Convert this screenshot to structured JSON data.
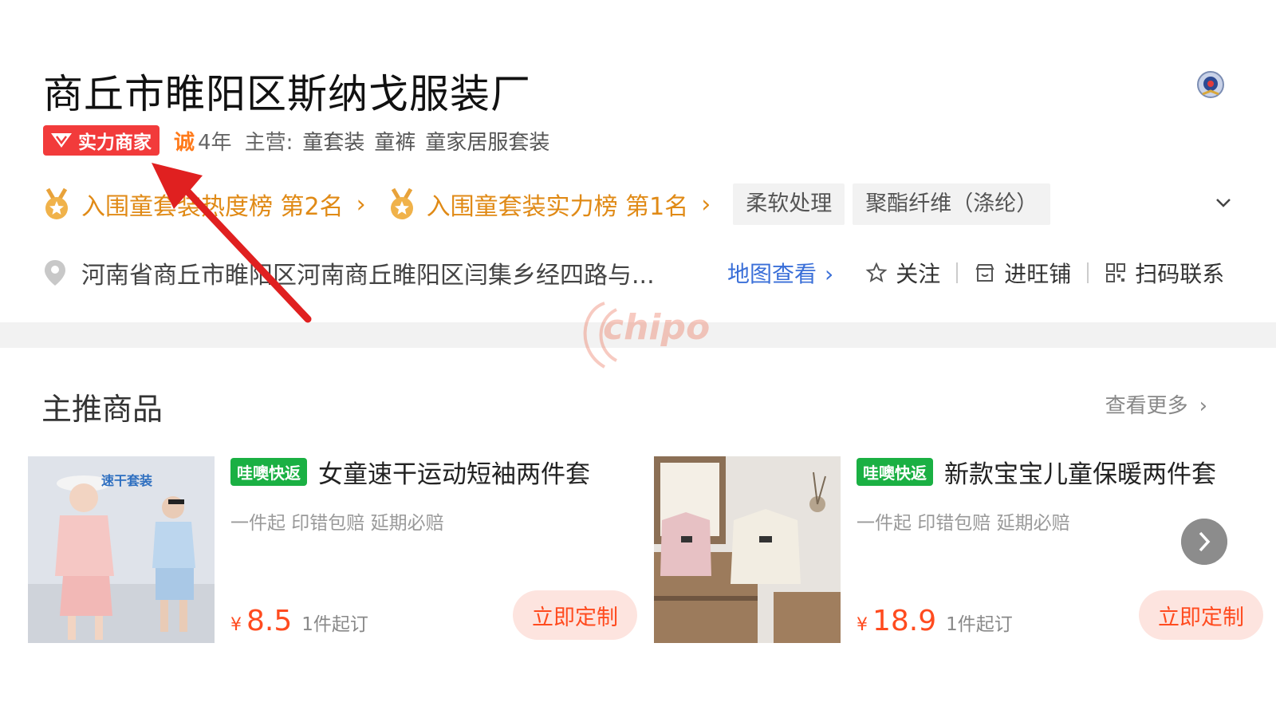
{
  "shop": {
    "name": "商丘市睢阳区斯纳戈服装厂",
    "strength_badge": "实力商家",
    "cheng_mark": "诚",
    "years": "4年",
    "main_label": "主营:",
    "categories": [
      "童套装",
      "童裤",
      "童家居服套装"
    ]
  },
  "rankings": [
    {
      "label": "入围童套装热度榜 第2名"
    },
    {
      "label": "入围童套装实力榜 第1名"
    }
  ],
  "tags": [
    "柔软处理",
    "聚酯纤维（涤纶）"
  ],
  "address": {
    "text": "河南省商丘市睢阳区河南商丘睢阳区闫集乡经四路与...",
    "map_link": "地图查看"
  },
  "actions": {
    "follow": "关注",
    "enter_shop": "进旺铺",
    "scan_contact": "扫码联系"
  },
  "watermark": "chipo",
  "featured": {
    "title": "主推商品",
    "see_more": "查看更多"
  },
  "products": [
    {
      "quick_tag": "哇噢快返",
      "name": "女童速干运动短袖两件套",
      "tags": "一件起 印错包赔 延期必赔",
      "currency": "¥",
      "price": "8.5",
      "moq": "1件起订",
      "button": "立即定制",
      "image_text": "速干套装"
    },
    {
      "quick_tag": "哇噢快返",
      "name": "新款宝宝儿童保暖两件套",
      "tags": "一件起 印错包赔 延期必赔",
      "currency": "¥",
      "price": "18.9",
      "moq": "1件起订",
      "button": "立即定制"
    }
  ],
  "colors": {
    "brand_red": "#f23b3b",
    "rank_gold": "#e08a16",
    "price_orange": "#ff4b1f",
    "link_blue": "#3a6fd8",
    "quick_green": "#1ab043"
  }
}
